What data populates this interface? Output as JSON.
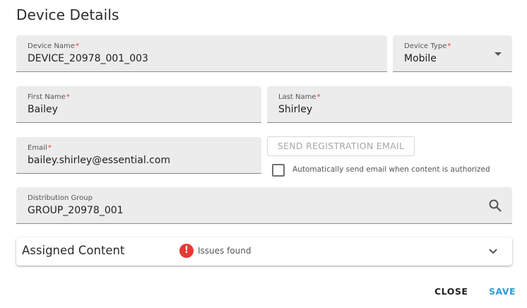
{
  "dialog": {
    "title": "Device Details"
  },
  "fields": {
    "device_name": {
      "label": "Device Name",
      "required_mark": "*",
      "value": "DEVICE_20978_001_003"
    },
    "device_type": {
      "label": "Device Type",
      "required_mark": "*",
      "value": "Mobile"
    },
    "first_name": {
      "label": "First Name",
      "required_mark": "*",
      "value": "Bailey"
    },
    "last_name": {
      "label": "Last Name",
      "required_mark": "*",
      "value": "Shirley"
    },
    "email": {
      "label": "Email",
      "required_mark": "*",
      "value": "bailey.shirley@essential.com"
    },
    "distribution_group": {
      "label": "Distribution Group",
      "value": "GROUP_20978_001"
    }
  },
  "registration": {
    "send_label": "SEND REGISTRATION EMAIL",
    "auto_send_label": "Automatically send email when content is authorized",
    "auto_send_checked": false
  },
  "assigned_content": {
    "title": "Assigned Content",
    "status": "Issues found",
    "status_icon": "!"
  },
  "actions": {
    "close_label": "CLOSE",
    "save_label": "SAVE"
  },
  "colors": {
    "required": "#e53935",
    "issue": "#e53935",
    "save": "#2d9bd6",
    "field_bg": "#ececec"
  }
}
